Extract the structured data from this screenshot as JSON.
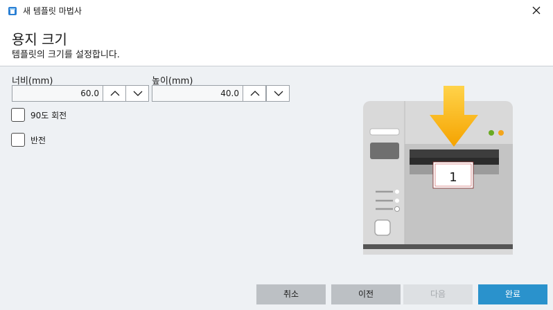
{
  "window": {
    "title": "새 템플릿 마법사",
    "icon": "app-icon"
  },
  "header": {
    "title": "용지 크기",
    "subtitle": "템플릿의 크기를 설정합니다."
  },
  "width_field": {
    "label": "너비(mm)",
    "value": "60.0"
  },
  "height_field": {
    "label": "높이(mm)",
    "value": "40.0"
  },
  "options": {
    "rotate_label": "90도 회전",
    "rotate_checked": false,
    "flip_label": "반전",
    "flip_checked": false
  },
  "preview": {
    "label_number": "1",
    "arrow_color": "#f5a800"
  },
  "buttons": {
    "cancel": "취소",
    "back": "이전",
    "next": "다음",
    "finish": "완료"
  },
  "colors": {
    "accent": "#2a92cc"
  }
}
